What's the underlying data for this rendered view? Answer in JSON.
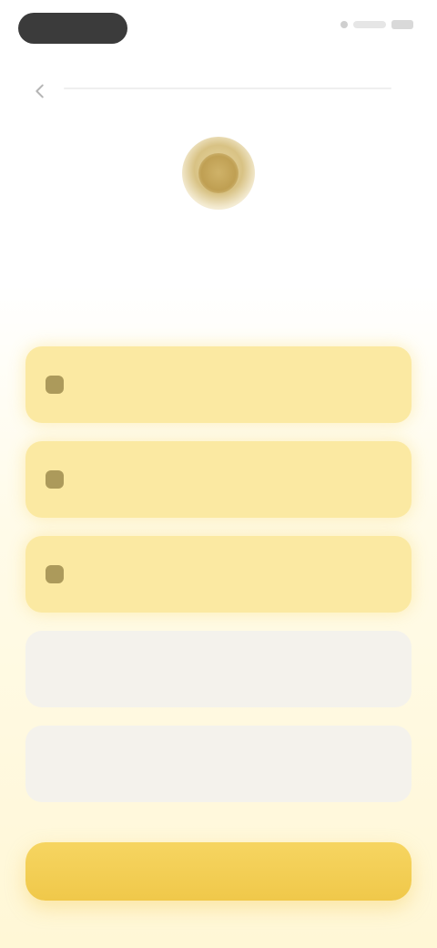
{
  "status_bar": {
    "icons": [
      "signal-icon",
      "wifi-icon",
      "battery-icon"
    ]
  },
  "header": {
    "back_icon": "chevron-left-icon"
  },
  "hero": {
    "logo_icon": "coin-icon",
    "heading": ""
  },
  "options": [
    {
      "label": "",
      "value": "",
      "state": "active",
      "icon": "option-icon"
    },
    {
      "label": "",
      "value": "",
      "state": "active",
      "icon": "option-icon"
    },
    {
      "label": "",
      "value": "",
      "state": "active",
      "icon": "option-icon"
    },
    {
      "label": "",
      "value": "",
      "state": "inactive",
      "icon": ""
    },
    {
      "label": "",
      "value": "",
      "state": "inactive",
      "icon": ""
    }
  ],
  "cta": {
    "label": ""
  },
  "colors": {
    "accent": "#f0c84a",
    "option_active": "#fbe9a2",
    "option_inactive": "#f4f2ec"
  }
}
